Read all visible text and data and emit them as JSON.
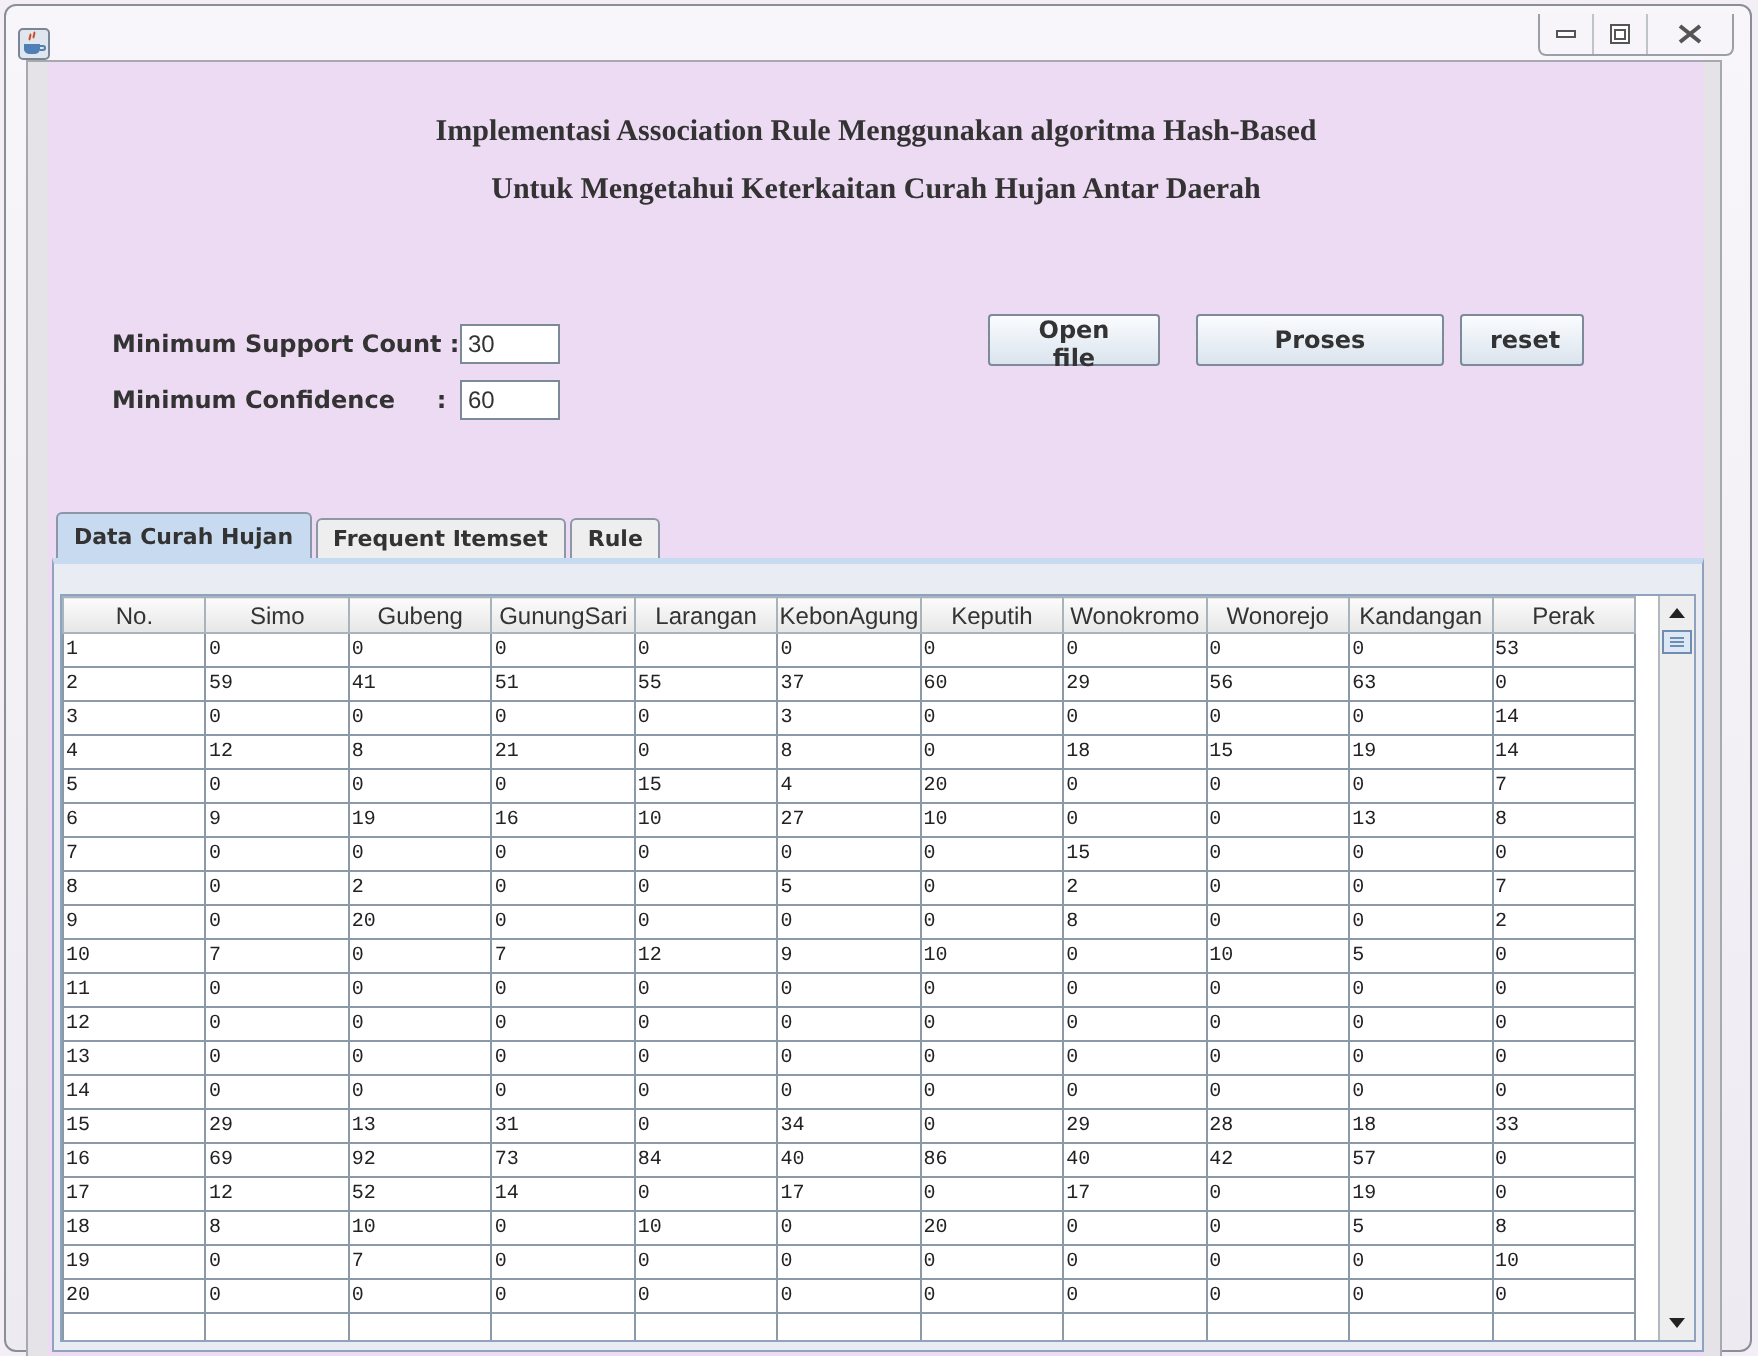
{
  "heading": [
    "Implementasi Association Rule Menggunakan algoritma Hash-Based",
    "Untuk Mengetahui Keterkaitan Curah Hujan Antar Daerah"
  ],
  "fields": [
    {
      "label": "Minimum Support Count :",
      "value": "30"
    },
    {
      "label": "Minimum Confidence     :",
      "value": "60"
    }
  ],
  "buttons": [
    "Open file",
    "Proses",
    "reset"
  ],
  "tabs": [
    {
      "label": "Data Curah Hujan",
      "selected": true
    },
    {
      "label": "Frequent Itemset",
      "selected": false
    },
    {
      "label": "Rule",
      "selected": false
    }
  ],
  "table": {
    "columns": [
      "No.",
      "Simo",
      "Gubeng",
      "GunungSari",
      "Larangan",
      "KebonAgung",
      "Keputih",
      "Wonokromo",
      "Wonorejo",
      "Kandangan",
      "Perak"
    ],
    "rows": [
      [
        "1",
        "0",
        "0",
        "0",
        "0",
        "0",
        "0",
        "0",
        "0",
        "0",
        "53"
      ],
      [
        "2",
        "59",
        "41",
        "51",
        "55",
        "37",
        "60",
        "29",
        "56",
        "63",
        "0"
      ],
      [
        "3",
        "0",
        "0",
        "0",
        "0",
        "3",
        "0",
        "0",
        "0",
        "0",
        "14"
      ],
      [
        "4",
        "12",
        "8",
        "21",
        "0",
        "8",
        "0",
        "18",
        "15",
        "19",
        "14"
      ],
      [
        "5",
        "0",
        "0",
        "0",
        "15",
        "4",
        "20",
        "0",
        "0",
        "0",
        "7"
      ],
      [
        "6",
        "9",
        "19",
        "16",
        "10",
        "27",
        "10",
        "0",
        "0",
        "13",
        "8"
      ],
      [
        "7",
        "0",
        "0",
        "0",
        "0",
        "0",
        "0",
        "15",
        "0",
        "0",
        "0"
      ],
      [
        "8",
        "0",
        "2",
        "0",
        "0",
        "5",
        "0",
        "2",
        "0",
        "0",
        "7"
      ],
      [
        "9",
        "0",
        "20",
        "0",
        "0",
        "0",
        "0",
        "8",
        "0",
        "0",
        "2"
      ],
      [
        "10",
        "7",
        "0",
        "7",
        "12",
        "9",
        "10",
        "0",
        "10",
        "5",
        "0"
      ],
      [
        "11",
        "0",
        "0",
        "0",
        "0",
        "0",
        "0",
        "0",
        "0",
        "0",
        "0"
      ],
      [
        "12",
        "0",
        "0",
        "0",
        "0",
        "0",
        "0",
        "0",
        "0",
        "0",
        "0"
      ],
      [
        "13",
        "0",
        "0",
        "0",
        "0",
        "0",
        "0",
        "0",
        "0",
        "0",
        "0"
      ],
      [
        "14",
        "0",
        "0",
        "0",
        "0",
        "0",
        "0",
        "0",
        "0",
        "0",
        "0"
      ],
      [
        "15",
        "29",
        "13",
        "31",
        "0",
        "34",
        "0",
        "29",
        "28",
        "18",
        "33"
      ],
      [
        "16",
        "69",
        "92",
        "73",
        "84",
        "40",
        "86",
        "40",
        "42",
        "57",
        "0"
      ],
      [
        "17",
        "12",
        "52",
        "14",
        "0",
        "17",
        "0",
        "17",
        "0",
        "19",
        "0"
      ],
      [
        "18",
        "8",
        "10",
        "0",
        "10",
        "0",
        "20",
        "0",
        "0",
        "5",
        "8"
      ],
      [
        "19",
        "0",
        "7",
        "0",
        "0",
        "0",
        "0",
        "0",
        "0",
        "0",
        "10"
      ],
      [
        "20",
        "0",
        "0",
        "0",
        "0",
        "0",
        "0",
        "0",
        "0",
        "0",
        "0"
      ]
    ]
  }
}
